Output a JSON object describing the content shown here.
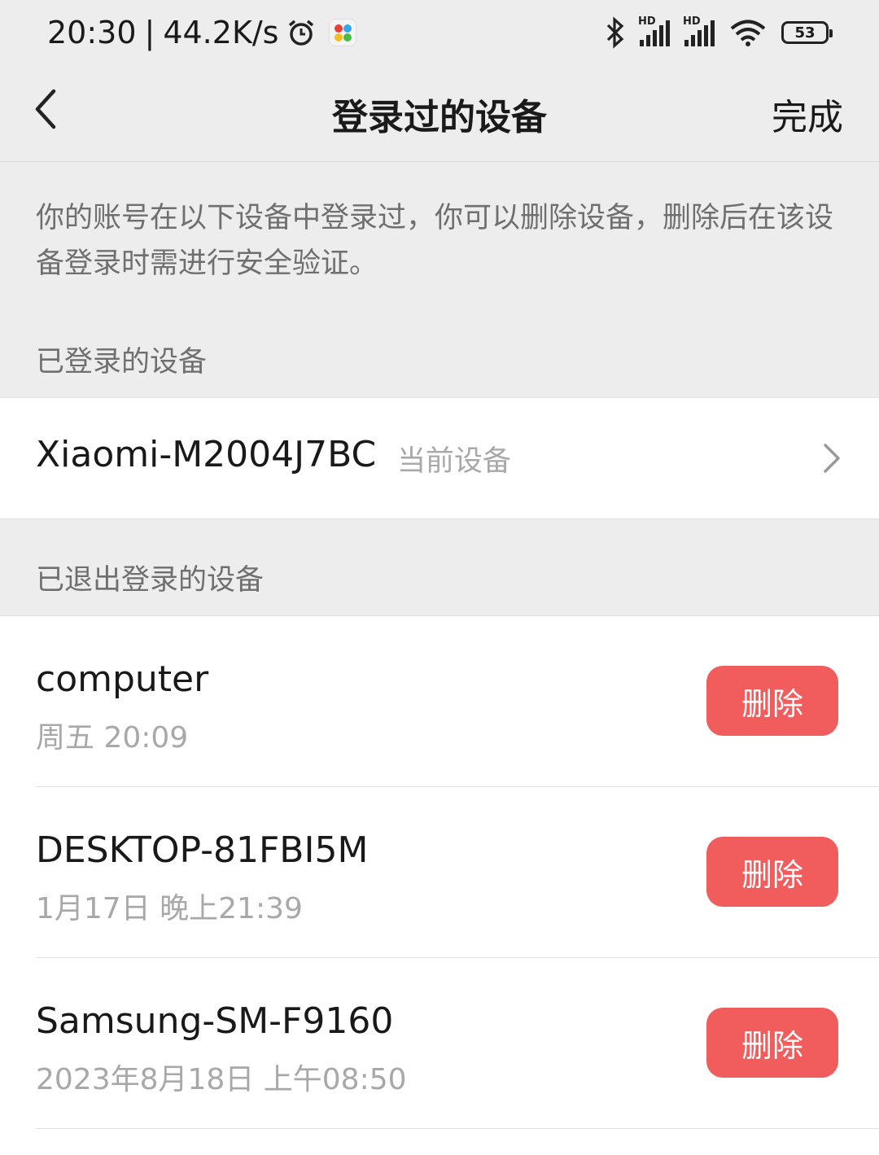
{
  "status_bar": {
    "time": "20:30",
    "separator": "|",
    "net_speed": "44.2K/s",
    "battery": "53",
    "signal_badge": "HD",
    "icons": [
      "alarm-icon",
      "app-icon",
      "bluetooth-icon",
      "signal-icon",
      "signal-icon",
      "wifi-icon",
      "battery-icon"
    ]
  },
  "nav": {
    "title": "登录过的设备",
    "done_label": "完成"
  },
  "intro_text": "你的账号在以下设备中登录过，你可以删除设备，删除后在该设备登录时需进行安全验证。",
  "logged_in": {
    "header": "已登录的设备",
    "device_name": "Xiaomi-M2004J7BC",
    "tag": "当前设备"
  },
  "logged_out": {
    "header": "已退出登录的设备",
    "delete_label": "删除",
    "devices": [
      {
        "name": "computer",
        "time": "周五 20:09"
      },
      {
        "name": "DESKTOP-81FBI5M",
        "time": "1月17日 晚上21:39"
      },
      {
        "name": "Samsung-SM-F9160",
        "time": "2023年8月18日 上午08:50"
      }
    ]
  },
  "colors": {
    "page_bg": "#ededed",
    "card_bg": "#ffffff",
    "delete_button": "#f15c5c",
    "secondary_text": "#a8a8a8"
  }
}
